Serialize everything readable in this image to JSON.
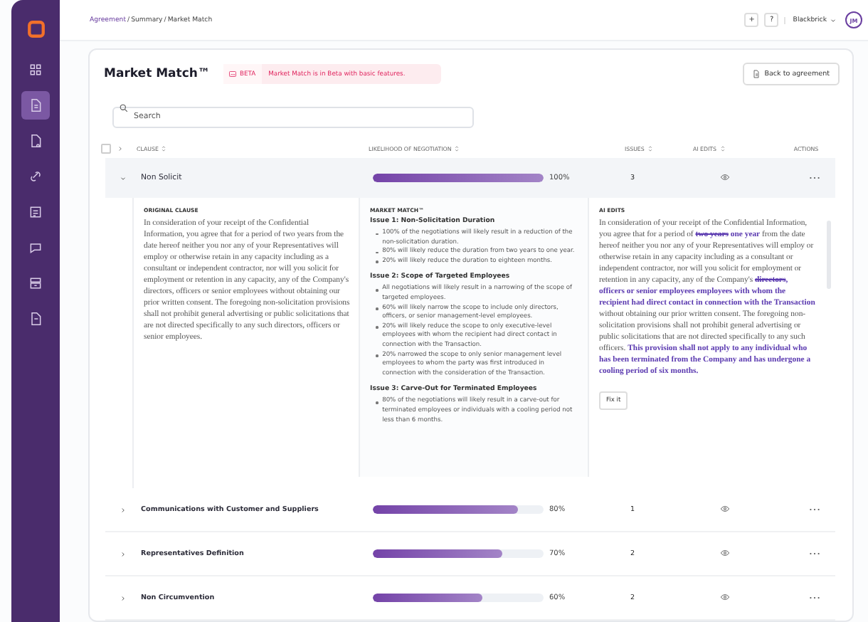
{
  "sidebar": {
    "items": [
      {
        "selected": false
      },
      {
        "selected": true
      },
      {
        "selected": false
      },
      {
        "selected": false
      },
      {
        "selected": false
      },
      {
        "selected": false
      },
      {
        "selected": false
      },
      {
        "selected": false
      }
    ]
  },
  "breadcrumb": {
    "separator": "/",
    "items": [
      {
        "label": "Agreement",
        "link": true
      },
      {
        "label": "Summary",
        "link": false
      },
      {
        "label": "Market Match",
        "link": false
      }
    ]
  },
  "top_bar": {
    "add": "+",
    "help": "?",
    "workspace": "Blackbrick",
    "avatar": "JM"
  },
  "page": {
    "title": "Market Match™",
    "beta": {
      "tag": "BETA",
      "message": "Market Match is in Beta with basic features."
    },
    "back_button": "Back to agreement",
    "search": {
      "placeholder": "Search"
    }
  },
  "table": {
    "checked": false,
    "columns": [
      {
        "label": "CLAUSE",
        "sortable": true
      },
      {
        "label": "LIKELIHOOD OF NEGOTIATION",
        "sortable": true
      },
      {
        "label": "ISSUES",
        "sortable": true
      },
      {
        "label": "AI EDITS",
        "sortable": true
      },
      {
        "label": "ACTIONS",
        "sortable": false
      }
    ],
    "rows": [
      {
        "clause": "Non Solicit",
        "level": 1.0,
        "reading": "100%",
        "issues": "3",
        "expanded": true
      },
      {
        "clause": "Communications with Customer and Suppliers",
        "level": 0.85,
        "reading": "80%",
        "issues": "1",
        "expanded": false
      },
      {
        "clause": "Representatives Definition",
        "level": 0.76,
        "reading": "70%",
        "issues": "2",
        "expanded": false
      },
      {
        "clause": "Non Circumvention",
        "level": 0.64,
        "reading": "60%",
        "issues": "2",
        "expanded": false
      }
    ],
    "detail": {
      "original": {
        "heading": "ORIGINAL CLAUSE",
        "text": "In consideration of your receipt of the Confidential Information, you agree that for a period of two years from the date hereof neither you nor any of your Representatives will employ or otherwise retain in any capacity including as a consultant or independent contractor, nor will you solicit for employment or retention in any capacity, any of the Company's directors, officers or senior employees without obtaining our prior written consent. The foregoing non-solicitation provisions shall not prohibit general advertising or public solicitations that are not directed specifically to any such directors, officers or senior employees."
      },
      "market_match": {
        "heading": "MARKET MATCH™",
        "issues": [
          {
            "title": "Issue 1: Non-Solicitation Duration",
            "points": [
              "100% of the negotiations will likely result in a reduction of the non-solicitation duration.",
              "80% will likely reduce the duration from two years to one year.",
              "20% will likely reduce the duration to eighteen months."
            ]
          },
          {
            "title": "Issue 2: Scope of Targeted Employees",
            "points": [
              "All negotiations will likely result in a narrowing of the scope of targeted employees.",
              "60% will likely narrow the scope to include only directors, officers, or senior management-level employees.",
              "20% will likely reduce the scope to only executive-level employees with whom the recipient had direct contact in connection with the Transaction.",
              "20% narrowed the scope to only senior management level employees to whom the party was first introduced in connection with the consideration of the Transaction."
            ]
          },
          {
            "title": "Issue 3: Carve-Out for Terminated Employees",
            "points": [
              "80% of the negotiations will likely result in a carve-out for terminated employees or individuals with a cooling period not less than 6 months."
            ]
          }
        ]
      },
      "ai_edits": {
        "heading": "AI EDITS",
        "segments": [
          {
            "kind": "plain",
            "text": "In consideration of your receipt of the Confidential Information, you agree that for a period of "
          },
          {
            "kind": "deleted",
            "text": "two years"
          },
          {
            "kind": "inserted",
            "text": " one year"
          },
          {
            "kind": "plain",
            "text": " from the date hereof neither you nor any of your Representatives will employ or otherwise retain in any capacity including as a consultant or independent contractor, nor will you solicit for employment or retention in any capacity, any of the Company's "
          },
          {
            "kind": "deleted",
            "text": "directors"
          },
          {
            "kind": "inserted",
            "text": ", officers or senior employees employees with whom the recipient had direct contact in connection with the Transaction"
          },
          {
            "kind": "plain",
            "text": " without obtaining our prior written consent. The foregoing non-solicitation provisions shall not prohibit general advertising or public solicitations that are not directed specifically to any such officers. "
          },
          {
            "kind": "inserted",
            "text": "This provision shall not apply to any individual who has been terminated from the Company and has undergone a cooling period of six months."
          }
        ],
        "button": "Fix it"
      }
    }
  }
}
